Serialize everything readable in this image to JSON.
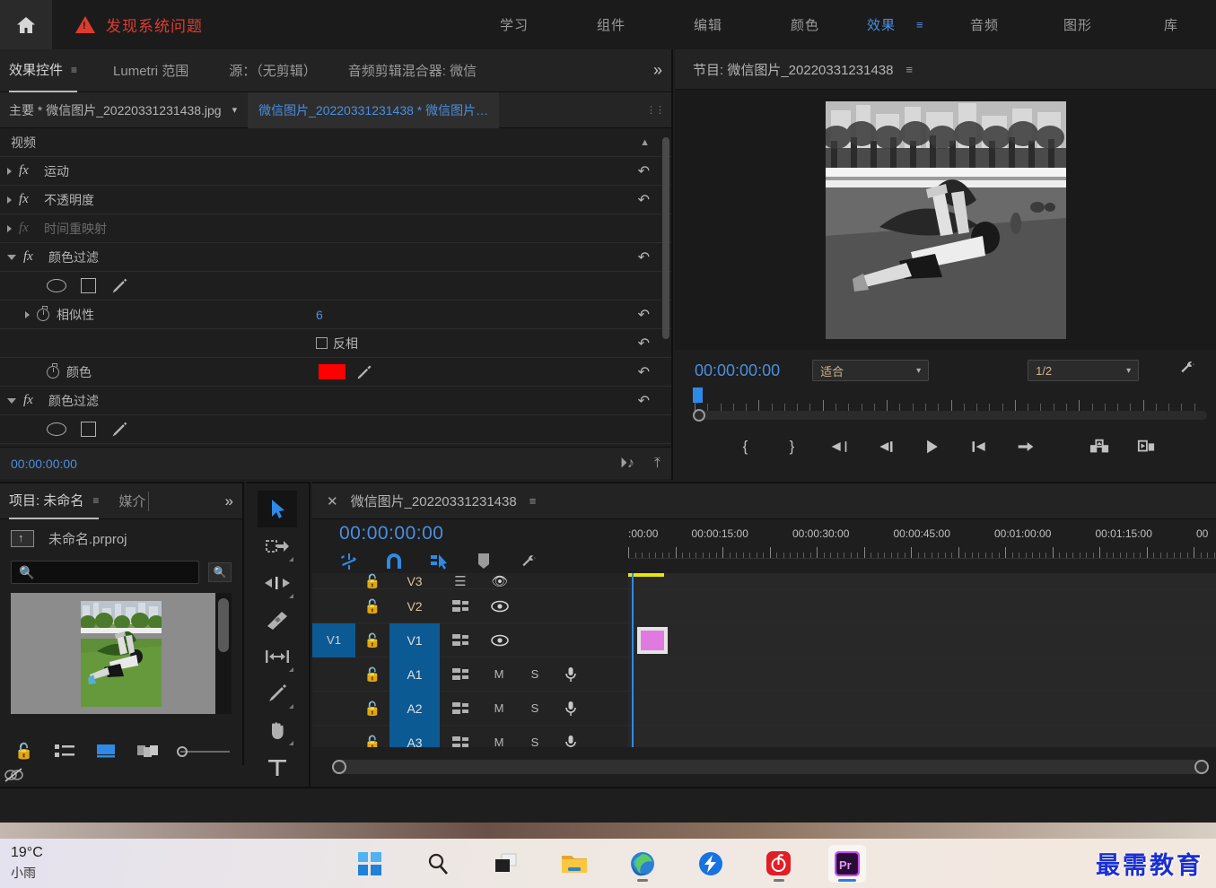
{
  "topbar": {
    "home_icon": "home-icon",
    "alert_icon": "alert-triangle-icon",
    "alert_text": "发现系统问题",
    "workspaces": [
      {
        "label": "学习",
        "active": false
      },
      {
        "label": "组件",
        "active": false
      },
      {
        "label": "编辑",
        "active": false
      },
      {
        "label": "颜色",
        "active": false
      },
      {
        "label": "效果",
        "active": true
      },
      {
        "label": "音频",
        "active": false
      },
      {
        "label": "图形",
        "active": false
      },
      {
        "label": "库",
        "active": false
      }
    ],
    "overflow_menu_icon": "hamburger-icon"
  },
  "effect_controls": {
    "tabs": [
      {
        "label": "效果控件",
        "active": true,
        "has_menu": true
      },
      {
        "label": "Lumetri 范围",
        "active": false
      },
      {
        "label": "源：（无剪辑）",
        "active": false
      },
      {
        "label": "音频剪辑混合器: 微信",
        "active": false
      }
    ],
    "overflow_icon": "chevron-double-right-icon",
    "clip_source": "主要 * 微信图片_20220331231438.jpg",
    "clip_sequence": "微信图片_20220331231438 * 微信图片…",
    "section_video": "视频",
    "rows": [
      {
        "name": "运动",
        "type": "effect",
        "expanded": false,
        "enabled": true
      },
      {
        "name": "不透明度",
        "type": "effect",
        "expanded": false,
        "enabled": true
      },
      {
        "name": "时间重映射",
        "type": "effect",
        "expanded": false,
        "enabled": false
      },
      {
        "name": "颜色过滤",
        "type": "effect",
        "expanded": true,
        "enabled": true
      },
      {
        "name": "相似性",
        "type": "param",
        "value": "6"
      },
      {
        "name": "反相",
        "type": "checkbox",
        "checked": false
      },
      {
        "name": "颜色",
        "type": "color",
        "value": "#ff0000"
      },
      {
        "name": "颜色过滤",
        "type": "effect",
        "expanded": true,
        "enabled": true
      }
    ],
    "similarity_label": "相似性",
    "similarity_value": "6",
    "invert_label": "反相",
    "color_label": "颜色",
    "color_value": "#ff0000",
    "reset_icon": "reset-icon",
    "eyedropper_icon": "eyedropper-icon",
    "ellipse_icon": "ellipse-mask-icon",
    "rect_icon": "rectangle-mask-icon",
    "pen_icon": "pen-mask-icon",
    "timecode": "00:00:00:00",
    "foot_icons": [
      "audio-preview-icon",
      "export-frame-icon"
    ]
  },
  "program_monitor": {
    "title": "节目: 微信图片_20220331231438",
    "menu_icon": "hamburger-icon",
    "timecode": "00:00:00:00",
    "fit_label": "适合",
    "resolution_label": "1/2",
    "settings_icon": "wrench-icon",
    "transport": [
      {
        "icon": "mark-in-icon",
        "label": "{"
      },
      {
        "icon": "mark-out-icon",
        "label": "}"
      },
      {
        "icon": "go-to-in-icon",
        "label": "{←"
      },
      {
        "icon": "step-back-icon",
        "label": "◀|"
      },
      {
        "icon": "play-icon",
        "label": "▶"
      },
      {
        "icon": "step-forward-icon",
        "label": "|▶"
      },
      {
        "icon": "go-to-out-icon",
        "label": "→}"
      },
      {
        "icon": "export-frame-icon",
        "label": ""
      },
      {
        "icon": "comparison-view-icon",
        "label": ""
      }
    ]
  },
  "project_panel": {
    "tab_label": "项目: 未命名",
    "tab_menu_icon": "hamburger-icon",
    "tab2_label": "媒介",
    "overflow_icon": "chevron-double-right-icon",
    "project_file": "未命名.prproj",
    "up_folder_icon": "parent-folder-icon",
    "search_placeholder": "",
    "search_value": "",
    "search_icon": "search-icon",
    "find_icon": "find-box-icon",
    "footer_icons": [
      "lock-icon",
      "list-view-icon",
      "icon-view-icon",
      "freeform-view-icon"
    ],
    "zoom_value": 0
  },
  "tools_panel": {
    "tools": [
      {
        "icon": "selection-tool-icon",
        "active": true
      },
      {
        "icon": "track-select-forward-tool-icon",
        "active": false
      },
      {
        "icon": "ripple-edit-tool-icon",
        "active": false
      },
      {
        "icon": "razor-tool-icon",
        "active": false
      },
      {
        "icon": "slip-tool-icon",
        "active": false
      },
      {
        "icon": "pen-tool-icon",
        "active": false
      },
      {
        "icon": "hand-tool-icon",
        "active": false
      },
      {
        "icon": "type-tool-icon",
        "active": false
      }
    ]
  },
  "timeline": {
    "close_icon": "close-icon",
    "title": "微信图片_20220331231438",
    "menu_icon": "hamburger-icon",
    "timecode": "00:00:00:00",
    "tools": [
      {
        "icon": "nest-sequence-icon",
        "active": true
      },
      {
        "icon": "snap-magnet-icon",
        "active": true
      },
      {
        "icon": "linked-selection-icon",
        "active": true
      },
      {
        "icon": "add-marker-icon",
        "active": false
      },
      {
        "icon": "timeline-settings-wrench-icon",
        "active": false
      }
    ],
    "ruler_labels": [
      ":00:00",
      "00:00:15:00",
      "00:00:30:00",
      "00:00:45:00",
      "00:01:00:00",
      "00:01:15:00",
      "00"
    ],
    "tracks": [
      {
        "name": "V3",
        "type": "video",
        "src": "",
        "src_on": false,
        "targeted": false,
        "has_clip": false
      },
      {
        "name": "V2",
        "type": "video",
        "src": "",
        "src_on": false,
        "targeted": false,
        "has_clip": false
      },
      {
        "name": "V1",
        "type": "video",
        "src": "V1",
        "src_on": true,
        "targeted": true,
        "has_clip": true
      },
      {
        "name": "A1",
        "type": "audio",
        "src": "",
        "src_on": false,
        "targeted": true,
        "has_clip": false
      },
      {
        "name": "A2",
        "type": "audio",
        "src": "",
        "src_on": false,
        "targeted": true,
        "has_clip": false
      },
      {
        "name": "A3",
        "type": "audio",
        "src": "",
        "src_on": false,
        "targeted": true,
        "has_clip": false
      }
    ],
    "track_controls": {
      "lock_icon": "lock-icon",
      "sync_icon": "sync-lock-icon",
      "eye_icon": "toggle-track-output-icon",
      "mute_label": "M",
      "solo_label": "S",
      "mic_icon": "voice-over-record-icon"
    },
    "clip_color": "#e07ae0"
  },
  "taskbar": {
    "temperature": "19°C",
    "weather": "小雨",
    "items": [
      {
        "icon": "windows-start-icon",
        "pinned": false,
        "running": false
      },
      {
        "icon": "search-icon",
        "pinned": false,
        "running": false
      },
      {
        "icon": "task-view-icon",
        "pinned": false,
        "running": false
      },
      {
        "icon": "file-explorer-icon",
        "pinned": false,
        "running": false
      },
      {
        "icon": "microsoft-edge-icon",
        "pinned": false,
        "running": true
      },
      {
        "icon": "thunder-download-icon",
        "pinned": false,
        "running": false
      },
      {
        "icon": "netease-music-icon",
        "pinned": false,
        "running": true
      },
      {
        "icon": "premiere-pro-icon",
        "pinned": true,
        "running": true
      }
    ],
    "watermark": "最需教育"
  },
  "colors": {
    "accent_blue": "#2e8ae6",
    "alert_red": "#e03a2f",
    "panel_bg": "#1e1e1e",
    "tab_bg": "#232323",
    "clip_pink": "#e07ae0",
    "track_blue": "#0c5a94",
    "yellow_marker": "#e8e800"
  }
}
